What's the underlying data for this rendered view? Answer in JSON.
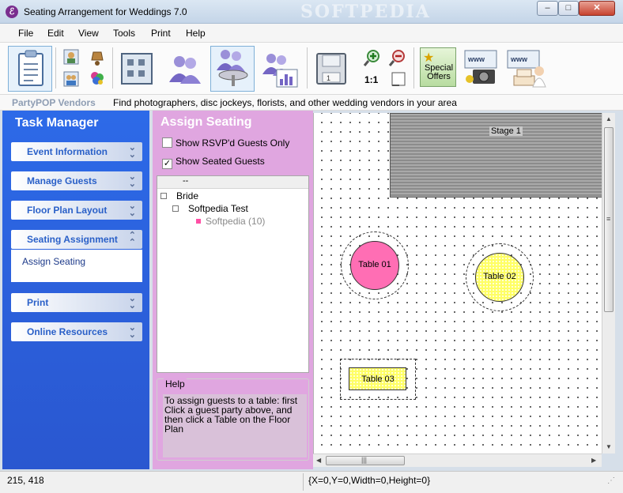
{
  "window": {
    "title": "Seating Arrangement for Weddings 7.0",
    "watermark": "SOFTPEDIA",
    "min_glyph": "–",
    "max_glyph": "□",
    "close_glyph": "✕"
  },
  "menu": {
    "items": [
      "File",
      "Edit",
      "View",
      "Tools",
      "Print",
      "Help"
    ]
  },
  "toolbar": {
    "zoom_reset_label": "1:1",
    "special_offers_label": "Special Offers",
    "icons": [
      "clipboard-icon",
      "guest-card-icon",
      "bell-icon",
      "couple-card-icon",
      "bouquet-icon",
      "floor-plan-icon",
      "people-icon",
      "people-table-icon",
      "people-chart-icon",
      "save-disk-icon",
      "zoom-in-icon",
      "zoom-out-icon",
      "fit-page-icon",
      "special-offers-icon",
      "photographer-icon",
      "wedding-cake-icon"
    ]
  },
  "vendor": {
    "brand": "PartyPOP Vendors",
    "text": "Find photographers, disc jockeys, florists, and other wedding vendors in your area"
  },
  "taskManager": {
    "title": "Task Manager",
    "groups": [
      {
        "label": "Event Information"
      },
      {
        "label": "Manage Guests"
      },
      {
        "label": "Floor Plan Layout"
      },
      {
        "label": "Seating Assignment"
      },
      {
        "label": "Print"
      },
      {
        "label": "Online Resources"
      }
    ],
    "active_sub": "Assign Seating"
  },
  "assign": {
    "title": "Assign Seating",
    "show_rsvp_label": "Show RSVP'd Guests Only",
    "show_rsvp_checked": false,
    "show_seated_label": "Show Seated Guests",
    "show_seated_checked": true,
    "list_header": "--",
    "tree": [
      {
        "label": "Bride",
        "level": 0
      },
      {
        "label": "Softpedia Test",
        "level": 1
      },
      {
        "label": "Softpedia (10)",
        "level": 2
      }
    ],
    "help_title": "Help",
    "help_text": "To assign guests to a table: first Click a guest party above, and then click a Table on the Floor Plan"
  },
  "floorplan": {
    "stage": "Stage 1",
    "tables": [
      {
        "label": "Table 01",
        "shape": "round",
        "color": "#ff6eb4"
      },
      {
        "label": "Table 02",
        "shape": "round",
        "color": "#ffff66"
      },
      {
        "label": "Table 03",
        "shape": "rect",
        "color": "#ffff66"
      }
    ]
  },
  "status": {
    "coords": "215, 418",
    "selection": "{X=0,Y=0,Width=0,Height=0}"
  }
}
